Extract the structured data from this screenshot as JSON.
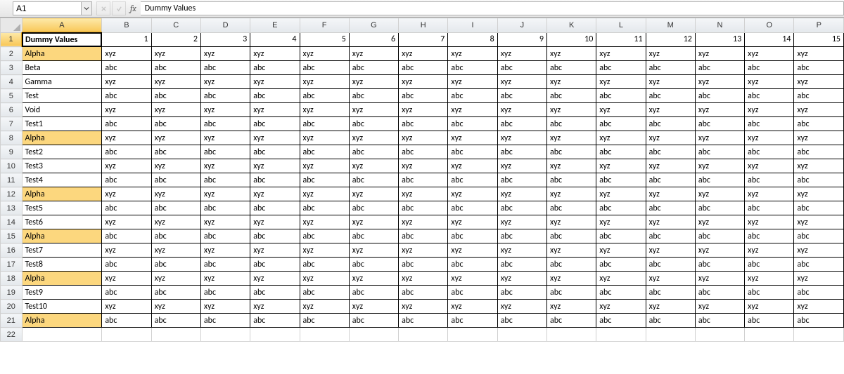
{
  "nameBox": "A1",
  "formulaBar": "Dummy Values",
  "fx": "fx",
  "columns": [
    "A",
    "B",
    "C",
    "D",
    "E",
    "F",
    "G",
    "H",
    "I",
    "J",
    "K",
    "L",
    "M",
    "N",
    "O",
    "P"
  ],
  "headerRow": [
    "Dummy Values",
    "1",
    "2",
    "3",
    "4",
    "5",
    "6",
    "7",
    "8",
    "9",
    "10",
    "11",
    "12",
    "13",
    "14",
    "15"
  ],
  "rows": [
    {
      "n": 2,
      "a": "Alpha",
      "v": "xyz",
      "hl": true
    },
    {
      "n": 3,
      "a": "Beta",
      "v": "abc",
      "hl": false
    },
    {
      "n": 4,
      "a": "Gamma",
      "v": "xyz",
      "hl": false
    },
    {
      "n": 5,
      "a": "Test",
      "v": "abc",
      "hl": false
    },
    {
      "n": 6,
      "a": "Void",
      "v": "xyz",
      "hl": false
    },
    {
      "n": 7,
      "a": "Test1",
      "v": "abc",
      "hl": false
    },
    {
      "n": 8,
      "a": "Alpha",
      "v": "xyz",
      "hl": true
    },
    {
      "n": 9,
      "a": "Test2",
      "v": "abc",
      "hl": false
    },
    {
      "n": 10,
      "a": "Test3",
      "v": "xyz",
      "hl": false
    },
    {
      "n": 11,
      "a": "Test4",
      "v": "abc",
      "hl": false
    },
    {
      "n": 12,
      "a": "Alpha",
      "v": "xyz",
      "hl": true
    },
    {
      "n": 13,
      "a": "Test5",
      "v": "abc",
      "hl": false
    },
    {
      "n": 14,
      "a": "Test6",
      "v": "xyz",
      "hl": false
    },
    {
      "n": 15,
      "a": "Alpha",
      "v": "abc",
      "hl": true
    },
    {
      "n": 16,
      "a": "Test7",
      "v": "xyz",
      "hl": false
    },
    {
      "n": 17,
      "a": "Test8",
      "v": "abc",
      "hl": false
    },
    {
      "n": 18,
      "a": "Alpha",
      "v": "xyz",
      "hl": true
    },
    {
      "n": 19,
      "a": "Test9",
      "v": "abc",
      "hl": false
    },
    {
      "n": 20,
      "a": "Test10",
      "v": "xyz",
      "hl": false
    },
    {
      "n": 21,
      "a": "Alpha",
      "v": "abc",
      "hl": true
    }
  ],
  "emptyRow": 22,
  "selectedCell": "A1"
}
